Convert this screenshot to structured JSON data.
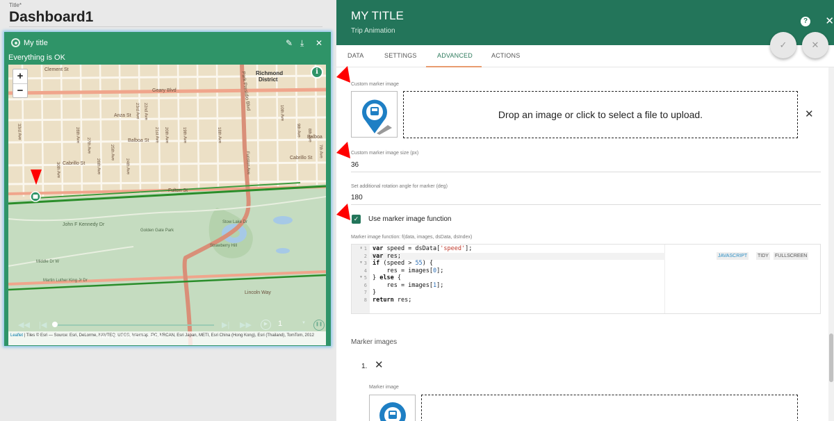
{
  "dashboard": {
    "title_label": "Title*",
    "title": "Dashboard1"
  },
  "widget": {
    "title": "My title",
    "status": "Everything is OK",
    "icons": [
      "locate-icon",
      "edit-icon",
      "download-icon",
      "close-icon"
    ],
    "map": {
      "zoom_in": "+",
      "zoom_out": "−",
      "labels": {
        "clement": "Clement St",
        "richmond1": "Richmond",
        "richmond2": "District",
        "geary": "Geary Blvd",
        "anza": "Anza St",
        "balboa": "Balboa St",
        "balboa2": "Balboa",
        "cabrillo": "Cabrillo St",
        "cabrillo2": "Cabrillo St",
        "fulton": "Fulton St",
        "jfk": "John F Kennedy Dr",
        "lincoln": "Lincoln Way",
        "stow": "Stow Lake Dr",
        "strawberry": "Strawberry Hill",
        "park_presidio": "Park Presidio Blvd",
        "funston": "Funston Ave",
        "av33": "33rd Ave",
        "av30": "30th Ave",
        "av28": "28th Ave",
        "av27": "27th Ave",
        "av26": "26th Ave",
        "av25": "25th Ave",
        "av24": "24th Ave",
        "av23": "23rd Ave",
        "av22": "22nd Ave",
        "av21": "21st Ave",
        "av20": "20th Ave",
        "av19": "19th Ave",
        "av18": "18th Ave",
        "av10": "10th Ave",
        "av9": "9th Ave",
        "av8": "8th Ave",
        "av7": "7th Ave",
        "golden_gate": "Golden Gate Park",
        "middle": "Middle Dr W",
        "martin": "Martin Luther King Jr Dr"
      },
      "attribution_link": "Leaflet",
      "attribution": " | Tiles © Esri — Source: Esri, DeLorme, NAVTEQ, USGS, Intermap, iPC, NRCAN, Esri Japan, METI, Esri China (Hong Kong), Esri (Thailand), TomTom, 2012"
    },
    "player": {
      "timestamp": "Nov 28, 2019 5:47:33 PM",
      "speed": "1",
      "progress": 0.0
    }
  },
  "panel": {
    "title": "MY TITLE",
    "subtitle": "Trip Animation",
    "tabs": [
      {
        "label": "DATA"
      },
      {
        "label": "SETTINGS"
      },
      {
        "label": "ADVANCED"
      },
      {
        "label": "ACTIONS"
      }
    ],
    "active_tab": "ADVANCED",
    "custom_marker_label": "Custom marker image",
    "drop_text": "Drop an image or click to select a file to upload.",
    "size_label": "Custom marker image size (px)",
    "size_value": "36",
    "rotation_label": "Set additional rotation angle for marker (deg)",
    "rotation_value": "180",
    "use_function_label": "Use marker image function",
    "use_function_checked": true,
    "function_label": "Marker image function: f(data, images, dsData, dsIndex)",
    "editor_buttons": [
      "JAVASCRIPT",
      "TIDY",
      "FULLSCREEN"
    ],
    "line_numbers": [
      "1",
      "2",
      "3",
      "4",
      "5",
      "6",
      "7",
      "8"
    ],
    "marker_images_title": "Marker images",
    "list_index": "1.",
    "marker_image_label": "Marker image"
  },
  "colors": {
    "widget_green": "#2f9468",
    "header_green": "#23755a",
    "tab_ink": "#e89c6f",
    "arrow_red": "#ff0000"
  }
}
